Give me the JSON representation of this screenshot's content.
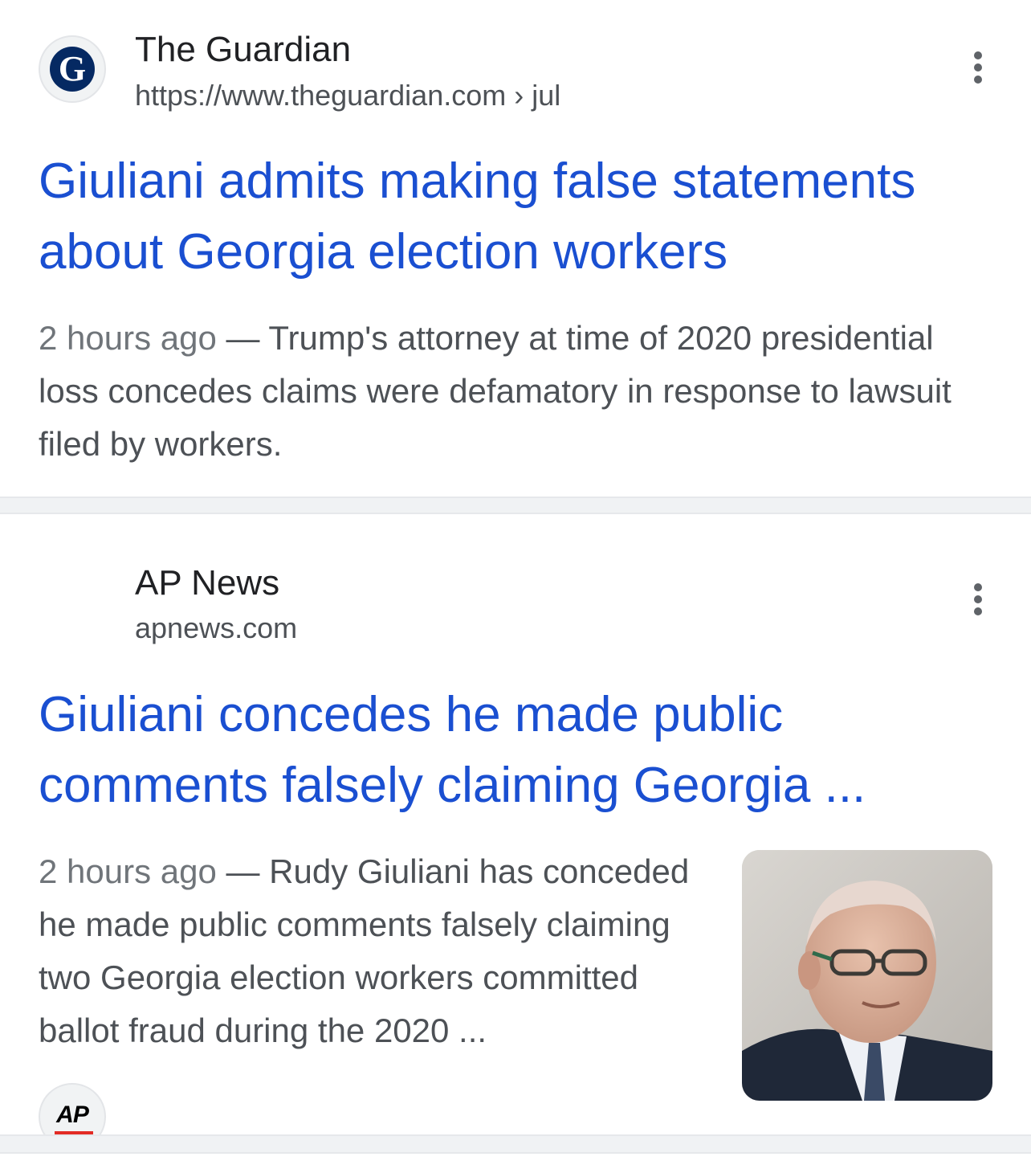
{
  "results": [
    {
      "source_name": "The Guardian",
      "source_url": "https://www.theguardian.com",
      "breadcrumb": "› jul",
      "favicon_icon": "guardian-logo-icon",
      "favicon_letter": "G",
      "headline": "Giuliani admits making false statements about Georgia election workers",
      "date": "2 hours ago",
      "snippet": "— Trump's attorney at time of 2020 presidential loss concedes claims were defamatory in response to lawsuit filed by workers."
    },
    {
      "source_name": "AP News",
      "source_url": "apnews.com",
      "favicon_icon": "ap-logo-icon",
      "favicon_letter": "AP",
      "headline": "Giuliani concedes he made public comments falsely claiming Georgia ...",
      "date": "2 hours ago",
      "snippet": "— Rudy Giuliani has conceded he made public comments falsely claiming two Georgia election workers committed ballot fraud during the 2020 ...",
      "thumbnail_icon": "giuliani-photo"
    }
  ],
  "menu_icon": "more-vertical-icon",
  "colors": {
    "headline": "#1a4fd1",
    "source": "#202124",
    "snippet": "#4d5156",
    "separator": "#f0f2f4",
    "ap_red": "#e22b25",
    "guardian_blue": "#052962"
  }
}
